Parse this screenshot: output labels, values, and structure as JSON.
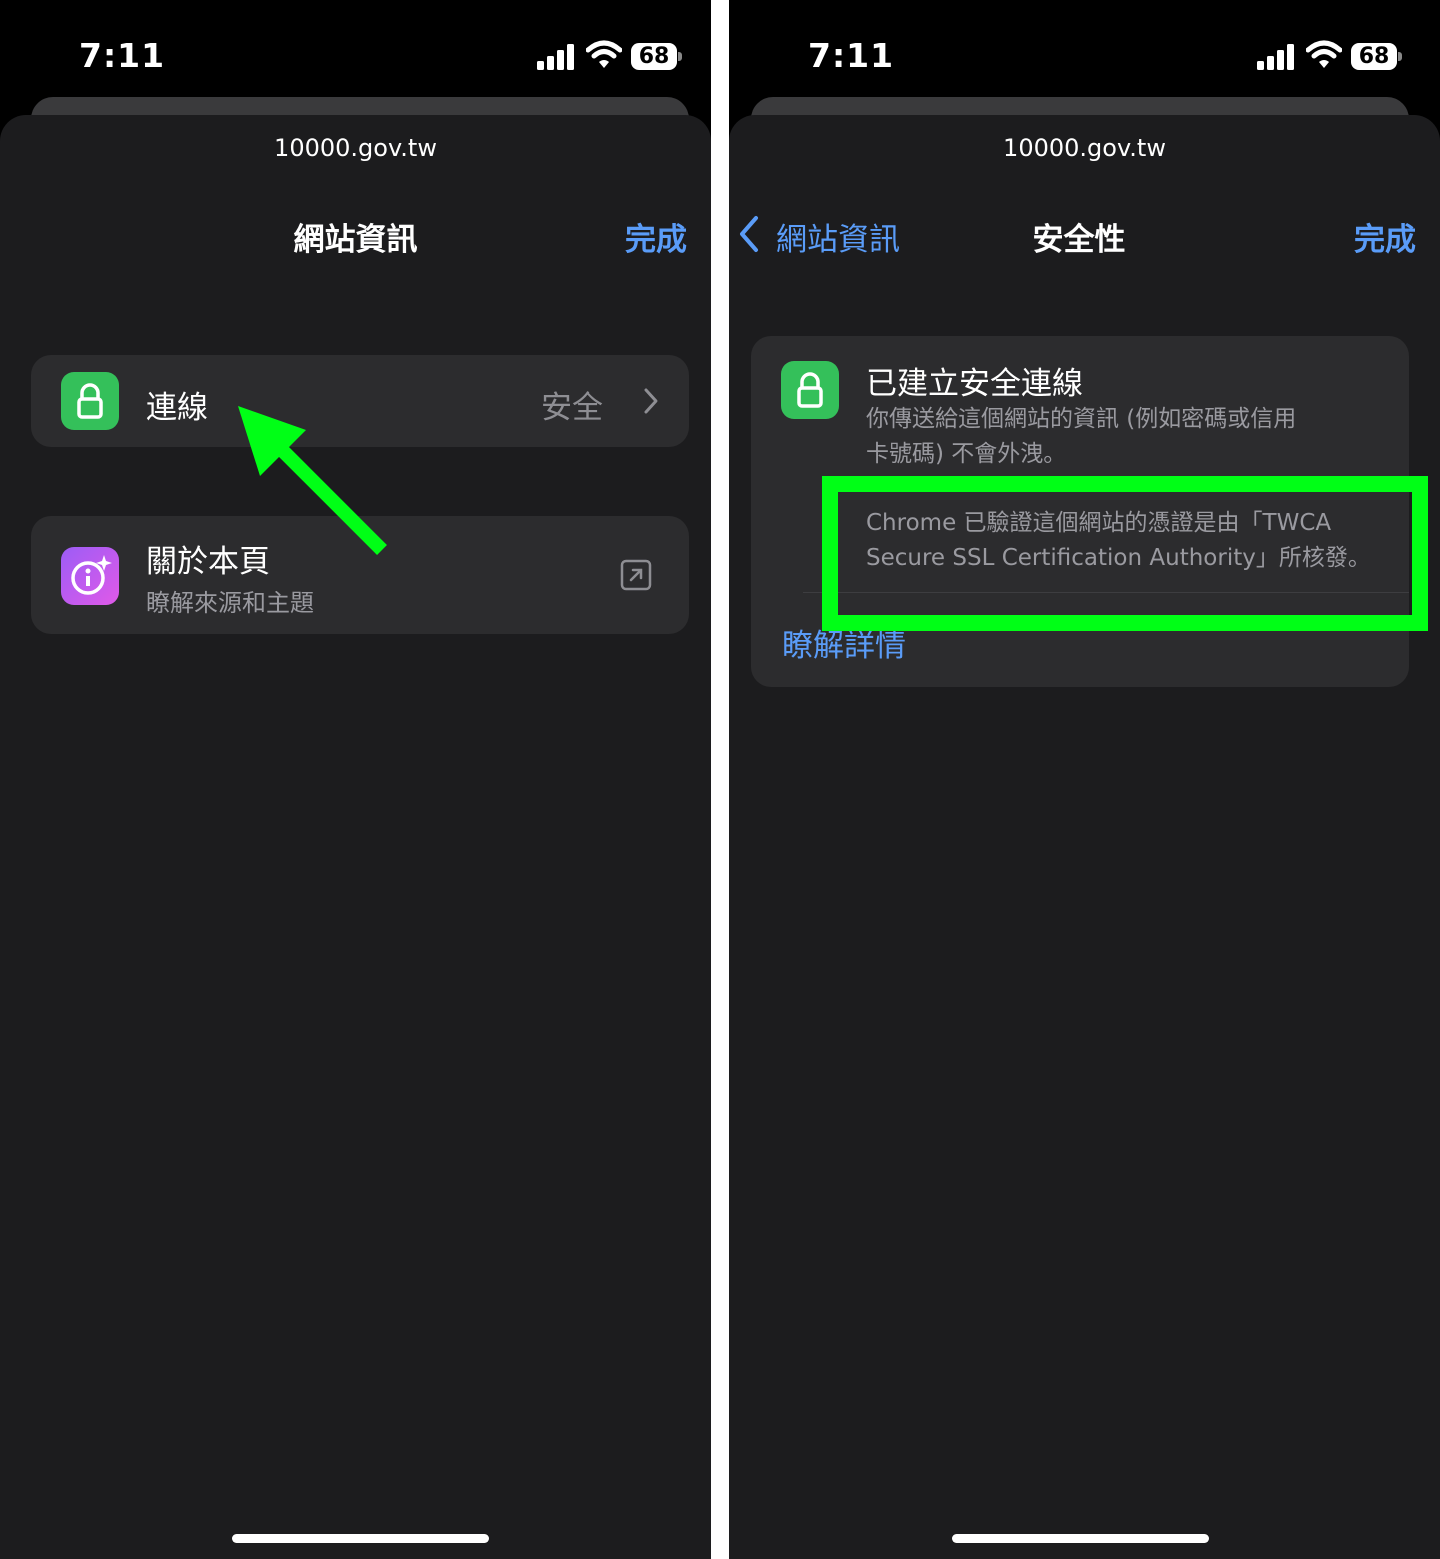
{
  "status": {
    "time": "7:11",
    "battery": "68"
  },
  "sheet": {
    "url": "10000.gov.tw",
    "done": "完成"
  },
  "left": {
    "title": "網站資訊",
    "connection": {
      "label": "連線",
      "value": "安全"
    },
    "about": {
      "label": "關於本頁",
      "sublabel": "瞭解來源和主題"
    }
  },
  "right": {
    "back": "網站資訊",
    "title": "安全性",
    "secure_title": "已建立安全連線",
    "secure_desc": "你傳送給這個網站的資訊 (例如密碼或信用卡號碼) 不會外洩。",
    "cert_desc": "Chrome 已驗證這個網站的憑證是由「TWCA Secure SSL Certification Authority」所核發。",
    "learn_more": "瞭解詳情"
  },
  "colors": {
    "accent": "#5a9cf8",
    "lock_green": "#34c05a",
    "highlight": "#00ff16",
    "sheet": "#1c1c1e"
  },
  "icons": [
    "signal-icon",
    "wifi-icon",
    "battery-icon",
    "lock-icon",
    "info-sparkle-icon",
    "chevron-right-icon",
    "open-external-icon",
    "chevron-left-icon"
  ]
}
